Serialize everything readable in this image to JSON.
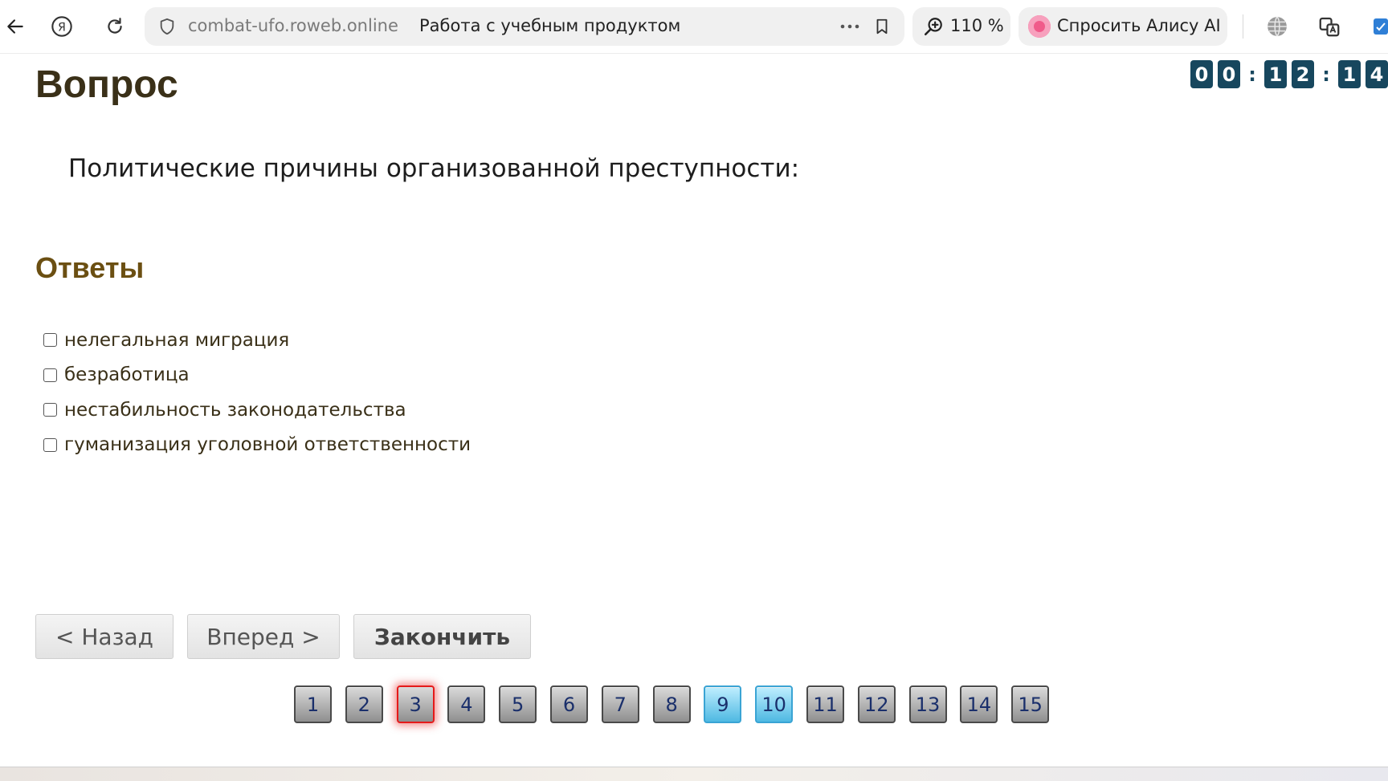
{
  "browser": {
    "url_domain": "combat-ufo.roweb.online",
    "page_title": "Работа с учебным продуктом",
    "zoom": "110 %",
    "alice_label": "Спросить Алису AI"
  },
  "timer": {
    "digits": [
      "0",
      "0",
      ":",
      "1",
      "2",
      ":",
      "1",
      "4"
    ]
  },
  "question": {
    "heading": "Вопрос",
    "text": "Политические причины организованной преступности:"
  },
  "answers": {
    "heading": "Ответы",
    "items": [
      {
        "label": "нелегальная миграция",
        "checked": false
      },
      {
        "label": "безработица",
        "checked": false
      },
      {
        "label": "нестабильность законодательства",
        "checked": false
      },
      {
        "label": "гуманизация уголовной ответственности",
        "checked": false
      }
    ]
  },
  "nav": {
    "back_label": "< Назад",
    "forward_label": "Вперед >",
    "finish_label": "Закончить"
  },
  "pages": [
    {
      "label": "1",
      "state": "default"
    },
    {
      "label": "2",
      "state": "default"
    },
    {
      "label": "3",
      "state": "current"
    },
    {
      "label": "4",
      "state": "default"
    },
    {
      "label": "5",
      "state": "default"
    },
    {
      "label": "6",
      "state": "default"
    },
    {
      "label": "7",
      "state": "default"
    },
    {
      "label": "8",
      "state": "default"
    },
    {
      "label": "9",
      "state": "answered"
    },
    {
      "label": "10",
      "state": "answered"
    },
    {
      "label": "11",
      "state": "default"
    },
    {
      "label": "12",
      "state": "default"
    },
    {
      "label": "13",
      "state": "default"
    },
    {
      "label": "14",
      "state": "default"
    },
    {
      "label": "15",
      "state": "default"
    }
  ],
  "colors": {
    "timer_digit": "#17475e",
    "heading_question": "#3a3018",
    "heading_answers": "#6b4f12",
    "page_answered": "#4fb9e2",
    "page_current_border": "#e51a1a"
  }
}
